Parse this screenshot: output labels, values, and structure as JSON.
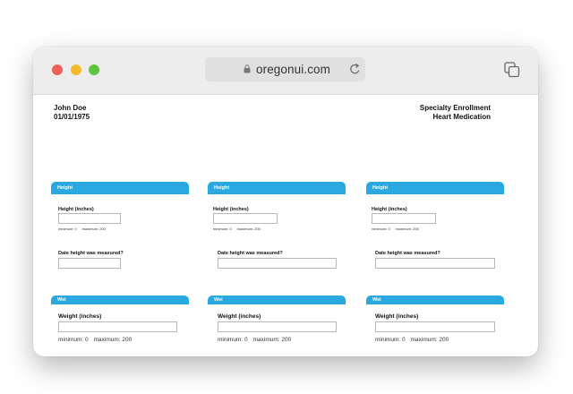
{
  "browser": {
    "url": "oregonui.com"
  },
  "patient": {
    "name": "John Doe",
    "dob": "01/01/1975"
  },
  "enrollment": {
    "line1": "Specialty Enrollment",
    "line2": "Heart Medication"
  },
  "height_cards": [
    {
      "header": "Height",
      "height_label": "Height  (inches)",
      "min_hint": "minimum: 0",
      "max_hint": "maximum: 200",
      "date_label": "Date height was measured?"
    },
    {
      "header": "Height",
      "height_label": "Height  (inches)",
      "min_hint": "minimum: 0",
      "max_hint": "maximum: 200",
      "date_label": "Date height was measured?"
    },
    {
      "header": "Height",
      "height_label": "Height  (inches)",
      "min_hint": "minimum: 0",
      "max_hint": "maximum: 200",
      "date_label": "Date height was measured?"
    }
  ],
  "weight_cards": [
    {
      "header": "Wei",
      "weight_label": "Weight  (inches)",
      "min_hint": "minimum: 0",
      "max_hint": "maximum: 200"
    },
    {
      "header": "Wei",
      "weight_label": "Weight  (inches)",
      "min_hint": "minimum: 0",
      "max_hint": "maximum: 200"
    },
    {
      "header": "Wei",
      "weight_label": "Weight  (inches)",
      "min_hint": "minimum: 0",
      "max_hint": "maximum: 200"
    }
  ],
  "colors": {
    "accent": "#2aa9e0"
  }
}
